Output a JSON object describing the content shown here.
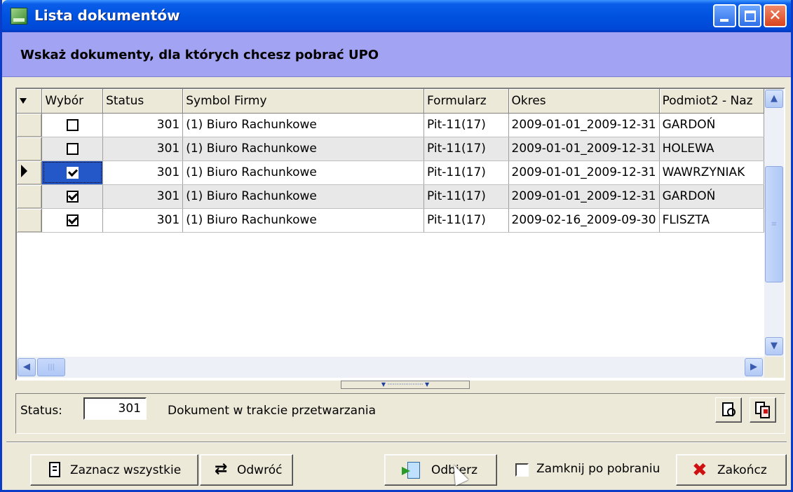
{
  "window": {
    "title": "Lista dokumentów",
    "header": "Wskaż dokumenty, dla których chcesz pobrać UPO"
  },
  "grid": {
    "columns": [
      "Wybór",
      "Status",
      "Symbol Firmy",
      "Formularz",
      "Okres",
      "Podmiot2 - Naz"
    ],
    "rows": [
      {
        "checked": false,
        "status": "301",
        "firma": "(1) Biuro Rachunkowe",
        "formularz": "Pit-11(17)",
        "okres": "2009-01-01_2009-12-31",
        "podmiot": "GARDOŃ"
      },
      {
        "checked": false,
        "status": "301",
        "firma": "(1) Biuro Rachunkowe",
        "formularz": "Pit-11(17)",
        "okres": "2009-01-01_2009-12-31",
        "podmiot": "HOLEWA"
      },
      {
        "checked": true,
        "status": "301",
        "firma": "(1) Biuro Rachunkowe",
        "formularz": "Pit-11(17)",
        "okres": "2009-01-01_2009-12-31",
        "podmiot": "WAWRZYNIAK"
      },
      {
        "checked": true,
        "status": "301",
        "firma": "(1) Biuro Rachunkowe",
        "formularz": "Pit-11(17)",
        "okres": "2009-01-01_2009-12-31",
        "podmiot": "GARDOŃ"
      },
      {
        "checked": true,
        "status": "301",
        "firma": "(1) Biuro Rachunkowe",
        "formularz": "Pit-11(17)",
        "okres": "2009-02-16_2009-09-30",
        "podmiot": "FLISZTA"
      }
    ],
    "current_row": 2
  },
  "status_bar": {
    "label": "Status:",
    "value": "301",
    "description": "Dokument w trakcie przetwarzania"
  },
  "buttons": {
    "select_all": "Zaznacz wszystkie",
    "invert": "Odwróć",
    "download": "Odbierz",
    "close_after_label": "Zamknij po pobraniu",
    "finish": "Zakończ"
  },
  "icons": {
    "app": "app-icon",
    "preview": "preview-icon",
    "copy": "copy-icon",
    "select_all": "checklist-icon",
    "invert": "invert-icon",
    "download": "download-icon",
    "finish": "close-x-icon"
  },
  "colors": {
    "titlebar": "#0052e0",
    "header_band": "#a3a3f3",
    "selection": "#2457c8",
    "window_bg": "#ece9d8"
  }
}
